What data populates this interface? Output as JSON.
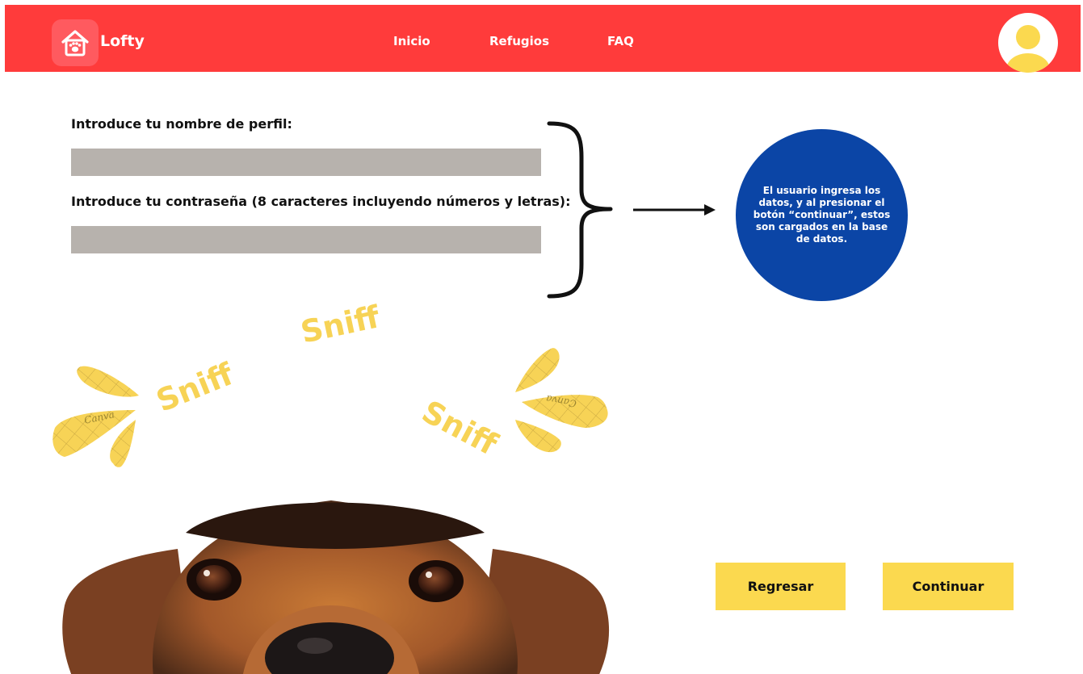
{
  "navbar": {
    "brand": "Lofty",
    "links": [
      "Inicio",
      "Refugios",
      "FAQ"
    ],
    "colors": {
      "bar": "#ff3b3b",
      "logo_bg": "#ff5a5f"
    }
  },
  "form": {
    "username_label": "Introduce tu nombre de perfil:",
    "username_value": "",
    "password_label": "Introduce tu contraseña (8 caracteres incluyendo números y letras):",
    "password_value": ""
  },
  "annotation": {
    "text": "El usuario ingresa los datos, y al presionar el botón “continuar”, estos son cargados en la base de datos.",
    "color": "#0b45a6"
  },
  "illustration": {
    "sniff_words": [
      "Sniff",
      "Sniff",
      "Sniff"
    ],
    "watermarks": [
      "Canva",
      "Canva"
    ],
    "accent": "#f7d356"
  },
  "buttons": {
    "back": "Regresar",
    "continue": "Continuar",
    "color": "#fbd94f"
  }
}
